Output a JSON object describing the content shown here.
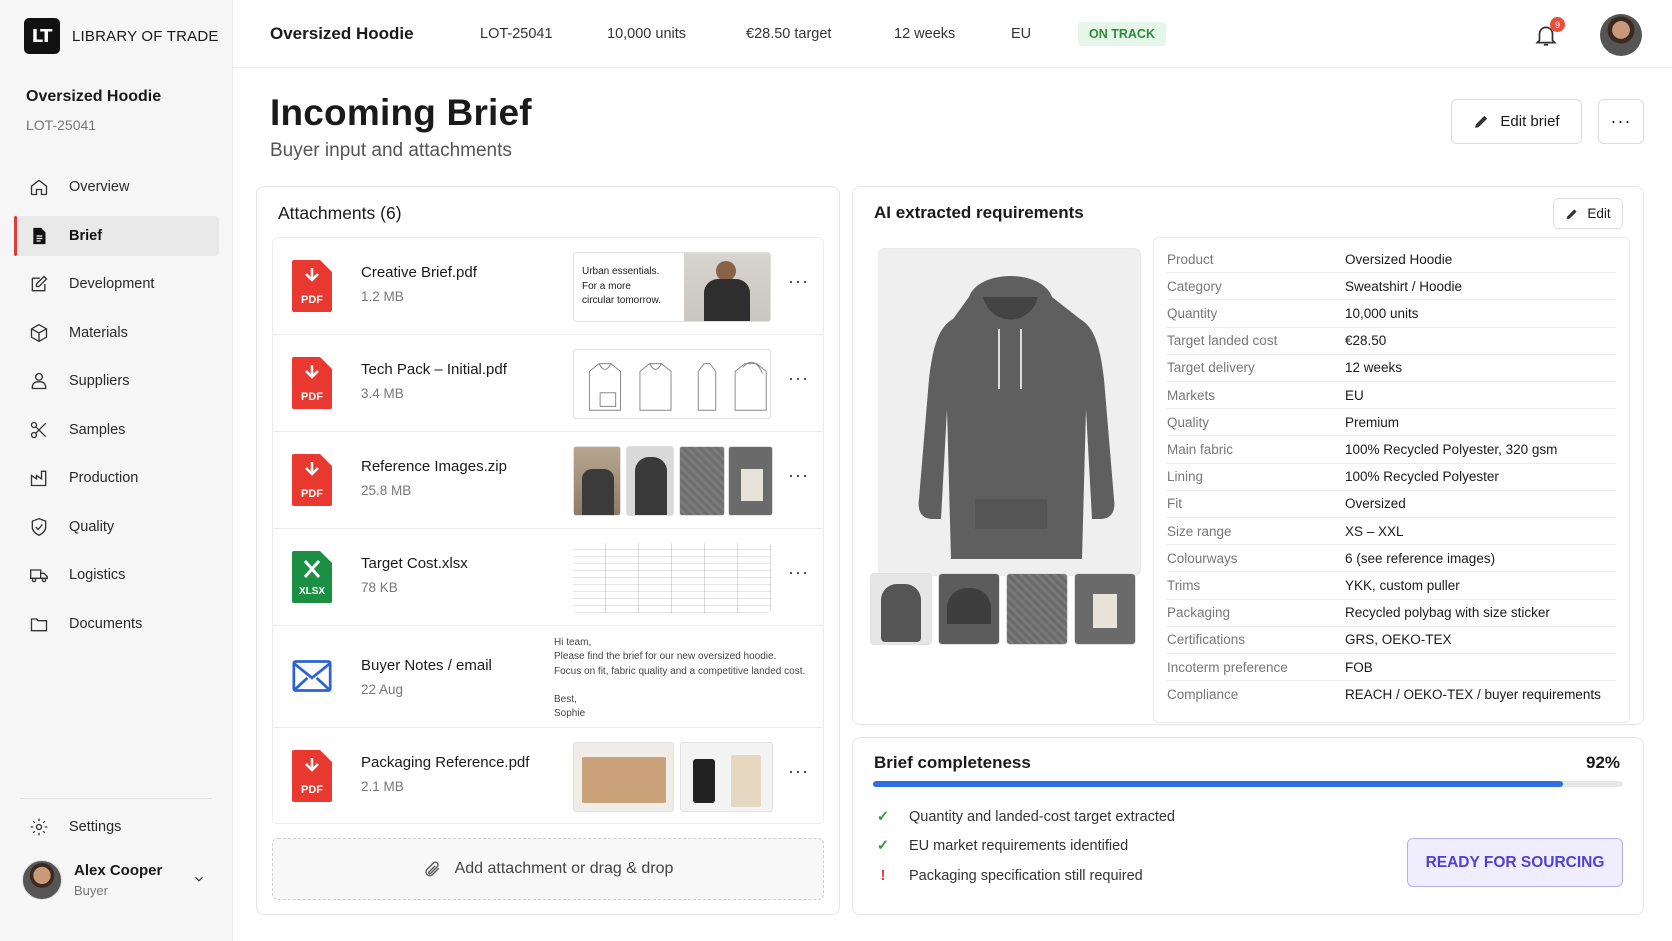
{
  "brand": {
    "mark": "LT",
    "name": "LIBRARY OF TRADE"
  },
  "project": {
    "name": "Oversized Hoodie",
    "code": "LOT-25041"
  },
  "nav": [
    {
      "label": "Overview",
      "icon": "home-icon"
    },
    {
      "label": "Brief",
      "icon": "document-icon",
      "active": true
    },
    {
      "label": "Development",
      "icon": "edit-square-icon"
    },
    {
      "label": "Materials",
      "icon": "cube-icon"
    },
    {
      "label": "Suppliers",
      "icon": "users-icon"
    },
    {
      "label": "Samples",
      "icon": "scissors-icon"
    },
    {
      "label": "Production",
      "icon": "factory-icon"
    },
    {
      "label": "Quality",
      "icon": "shield-check-icon"
    },
    {
      "label": "Logistics",
      "icon": "truck-icon"
    },
    {
      "label": "Documents",
      "icon": "folder-icon"
    }
  ],
  "settings_label": "Settings",
  "user": {
    "name": "Alex Cooper",
    "role": "Buyer"
  },
  "topbar": {
    "title": "Oversized Hoodie",
    "code": "LOT-25041",
    "units": "10,000 units",
    "target": "€28.50 target",
    "weeks": "12 weeks",
    "market": "EU",
    "status": "ON TRACK",
    "notifications": "9"
  },
  "page": {
    "title": "Incoming Brief",
    "subtitle": "Buyer input and attachments",
    "edit_label": "Edit brief",
    "more_label": "···"
  },
  "attachments": {
    "title": "Attachments (6)",
    "items": [
      {
        "name": "Creative Brief.pdf",
        "size": "1.2 MB",
        "type": "PDF",
        "preview_text": "Urban essentials.\nFor a more\ncircular tomorrow."
      },
      {
        "name": "Tech Pack – Initial.pdf",
        "size": "3.4 MB",
        "type": "PDF"
      },
      {
        "name": "Reference Images.zip",
        "size": "25.8 MB",
        "type": "PDF"
      },
      {
        "name": "Target Cost.xlsx",
        "size": "78 KB",
        "type": "XLSX"
      },
      {
        "name": "Buyer Notes / email",
        "size": "22 Aug",
        "type": "EMAIL",
        "preview_text": "Hi team,\nPlease find the brief for our new oversized hoodie.\nFocus on fit, fabric quality and a competitive landed cost.\n\nBest,\nSophie"
      },
      {
        "name": "Packaging Reference.pdf",
        "size": "2.1 MB",
        "type": "PDF"
      }
    ],
    "add_label": "Add attachment or drag & drop",
    "more_label": "···"
  },
  "requirements": {
    "title": "AI extracted requirements",
    "edit_label": "Edit",
    "rows": [
      {
        "k": "Product",
        "v": "Oversized Hoodie"
      },
      {
        "k": "Category",
        "v": "Sweatshirt / Hoodie"
      },
      {
        "k": "Quantity",
        "v": "10,000 units"
      },
      {
        "k": "Target landed cost",
        "v": "€28.50"
      },
      {
        "k": "Target delivery",
        "v": "12 weeks"
      },
      {
        "k": "Markets",
        "v": "EU"
      },
      {
        "k": "Quality",
        "v": "Premium"
      },
      {
        "k": "Main fabric",
        "v": "100% Recycled Polyester, 320 gsm"
      },
      {
        "k": "Lining",
        "v": "100% Recycled Polyester"
      },
      {
        "k": "Fit",
        "v": "Oversized"
      },
      {
        "k": "Size range",
        "v": "XS – XXL"
      },
      {
        "k": "Colourways",
        "v": "6 (see reference images)"
      },
      {
        "k": "Trims",
        "v": "YKK, custom puller"
      },
      {
        "k": "Packaging",
        "v": "Recycled polybag with size sticker"
      },
      {
        "k": "Certifications",
        "v": "GRS, OEKO-TEX"
      },
      {
        "k": "Incoterm preference",
        "v": "FOB"
      },
      {
        "k": "Compliance",
        "v": "REACH / OEKO-TEX / buyer requirements"
      }
    ]
  },
  "completeness": {
    "title": "Brief completeness",
    "percent_label": "92%",
    "progress_fraction": 0.92,
    "checks": [
      {
        "text": "Quantity and landed-cost target extracted",
        "status": "ok"
      },
      {
        "text": "EU market requirements identified",
        "status": "ok"
      },
      {
        "text": "Packaging specification still required",
        "status": "warn"
      }
    ],
    "ready_label": "READY FOR SOURCING"
  },
  "colors": {
    "accent": "#2f6fe0",
    "pdf_red": "#e8382f",
    "xlsx_green": "#1d8f45",
    "mail_blue": "#2b63d6",
    "status_green": "#2f8a3b",
    "ready_purple": "#5040d8"
  }
}
